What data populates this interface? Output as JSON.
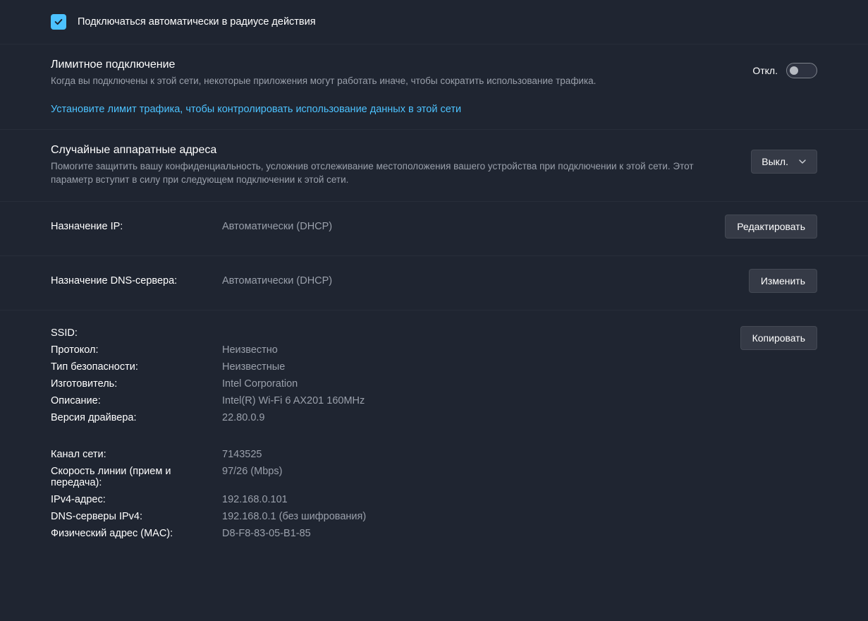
{
  "autoConnect": {
    "label": "Подключаться автоматически в радиусе действия",
    "checked": true
  },
  "metered": {
    "title": "Лимитное подключение",
    "desc": "Когда вы подключены к этой сети, некоторые приложения могут работать иначе, чтобы сократить использование трафика.",
    "link": "Установите лимит трафика, чтобы контролировать использование данных в этой сети",
    "toggleLabel": "Откл."
  },
  "randomMac": {
    "title": "Случайные аппаратные адреса",
    "desc": "Помогите защитить вашу конфиденциальность, усложнив отслеживание местоположения вашего устройства при подключении к этой сети. Этот параметр вступит в силу при следующем подключении к этой сети.",
    "selected": "Выкл."
  },
  "ip": {
    "label": "Назначение IP:",
    "value": "Автоматически (DHCP)",
    "button": "Редактировать"
  },
  "dns": {
    "label": "Назначение DNS-сервера:",
    "value": "Автоматически (DHCP)",
    "button": "Изменить"
  },
  "info": {
    "copyButton": "Копировать",
    "rows": [
      {
        "k": "SSID:",
        "v": ""
      },
      {
        "k": "Протокол:",
        "v": "Неизвестно"
      },
      {
        "k": "Тип безопасности:",
        "v": "Неизвестные"
      },
      {
        "k": "Изготовитель:",
        "v": "Intel Corporation"
      },
      {
        "k": "Описание:",
        "v": "Intel(R) Wi-Fi 6 AX201 160MHz"
      },
      {
        "k": "Версия драйвера:",
        "v": "22.80.0.9"
      }
    ],
    "rows2": [
      {
        "k": "Канал сети:",
        "v": "7143525"
      },
      {
        "k": "Скорость линии (прием и передача):",
        "v": "97/26 (Mbps)"
      },
      {
        "k": "IPv4-адрес:",
        "v": "192.168.0.101"
      },
      {
        "k": "DNS-серверы IPv4:",
        "v": "192.168.0.1 (без шифрования)"
      },
      {
        "k": "Физический адрес (MAC):",
        "v": "D8-F8-83-05-B1-85"
      }
    ]
  }
}
